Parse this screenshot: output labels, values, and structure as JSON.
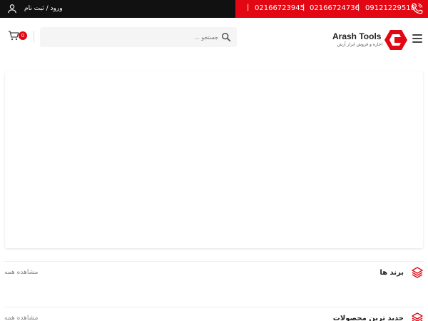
{
  "topbar": {
    "phones": [
      "09121229518",
      "02166724736",
      "02166723945"
    ],
    "login_label": "ورود / ثبت نام"
  },
  "header": {
    "logo_title": "Arash Tools",
    "logo_subtitle": "اجاره و فروش ابزار آرش",
    "search_placeholder": "جستجو ...",
    "cart_count": "0"
  },
  "sections": [
    {
      "title": "برند ها",
      "view_all": "مشاهده همه"
    },
    {
      "title": "جدید ترین محصولات",
      "view_all": "مشاهده همه"
    }
  ],
  "colors": {
    "accent": "#e30613",
    "topbar": "#111111"
  }
}
